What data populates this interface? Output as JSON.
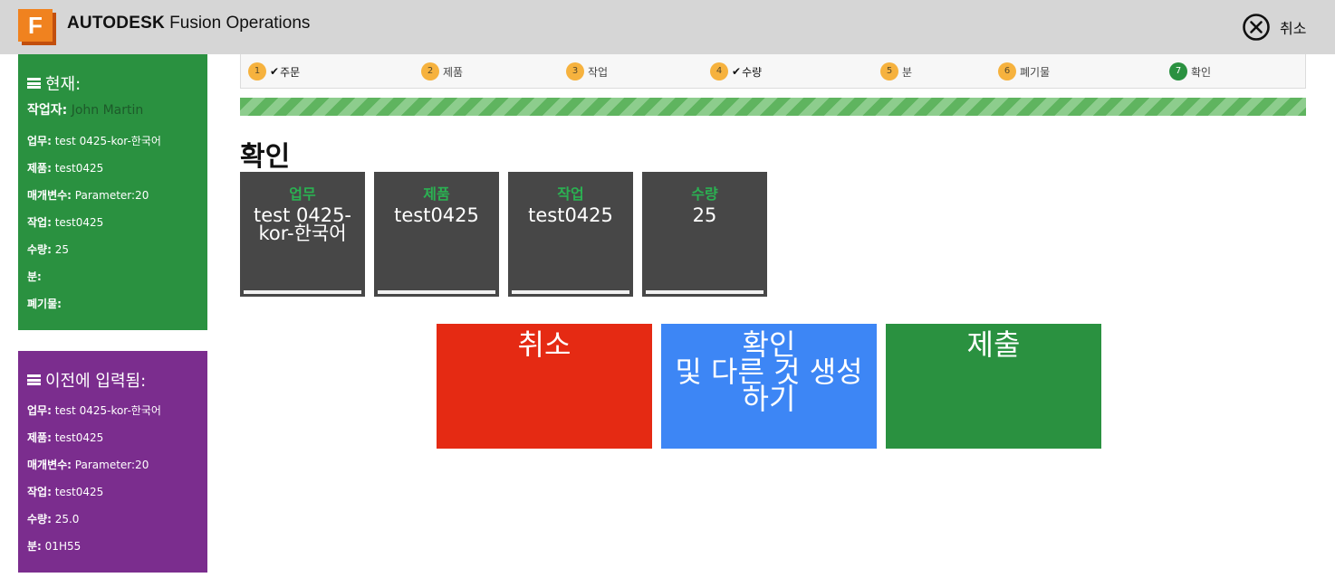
{
  "header": {
    "logo_letter": "F",
    "brand_bold": "AUTODESK",
    "brand_rest": "Fusion Operations",
    "cancel_label": "취소"
  },
  "current_panel": {
    "title": "현재:",
    "worker_key": "작업자:",
    "worker_value": "John Martin",
    "rows": [
      {
        "key": "업무:",
        "value": "test 0425-kor-한국어"
      },
      {
        "key": "제품:",
        "value": "test0425"
      },
      {
        "key": "매개변수:",
        "value": "Parameter:20"
      },
      {
        "key": "작업:",
        "value": "test0425"
      },
      {
        "key": "수량:",
        "value": "25"
      },
      {
        "key": "분:",
        "value": ""
      },
      {
        "key": "폐기물:",
        "value": ""
      }
    ]
  },
  "previous_panel": {
    "title": "이전에 입력됨:",
    "rows": [
      {
        "key": "업무:",
        "value": "test 0425-kor-한국어"
      },
      {
        "key": "제품:",
        "value": "test0425"
      },
      {
        "key": "매개변수:",
        "value": "Parameter:20"
      },
      {
        "key": "작업:",
        "value": "test0425"
      },
      {
        "key": "수량:",
        "value": "25.0"
      },
      {
        "key": "분:",
        "value": "01H55"
      }
    ]
  },
  "stepper": {
    "steps": [
      {
        "num": "1",
        "label": "주문",
        "checked": true
      },
      {
        "num": "2",
        "label": "제품",
        "checked": false
      },
      {
        "num": "3",
        "label": "작업",
        "checked": false
      },
      {
        "num": "4",
        "label": "수량",
        "checked": true
      },
      {
        "num": "5",
        "label": "분",
        "checked": false
      },
      {
        "num": "6",
        "label": "폐기물",
        "checked": false
      },
      {
        "num": "7",
        "label": "확인",
        "checked": false
      }
    ],
    "check_glyph": "✔",
    "progress_percent": 100
  },
  "main": {
    "title": "확인",
    "cards": [
      {
        "title": "업무",
        "value": "test 0425-kor-한국어"
      },
      {
        "title": "제품",
        "value": "test0425"
      },
      {
        "title": "작업",
        "value": "test0425"
      },
      {
        "title": "수량",
        "value": "25"
      }
    ],
    "buttons": {
      "cancel": "취소",
      "confirm_line1": "확인",
      "confirm_line2": "및 다른 것 생성",
      "confirm_line3": "하기",
      "submit": "제출"
    }
  },
  "colors": {
    "current_panel": "#2a9140",
    "previous_panel": "#7b2d8e",
    "cancel_button": "#e52a13",
    "confirm_button": "#3d86f5",
    "submit_button": "#2a9140",
    "step_pending": "#f6b23e",
    "step_active": "#2a9140"
  },
  "icons": {
    "close": "close-circle-icon",
    "menu": "hamburger-icon",
    "check": "check-icon"
  }
}
